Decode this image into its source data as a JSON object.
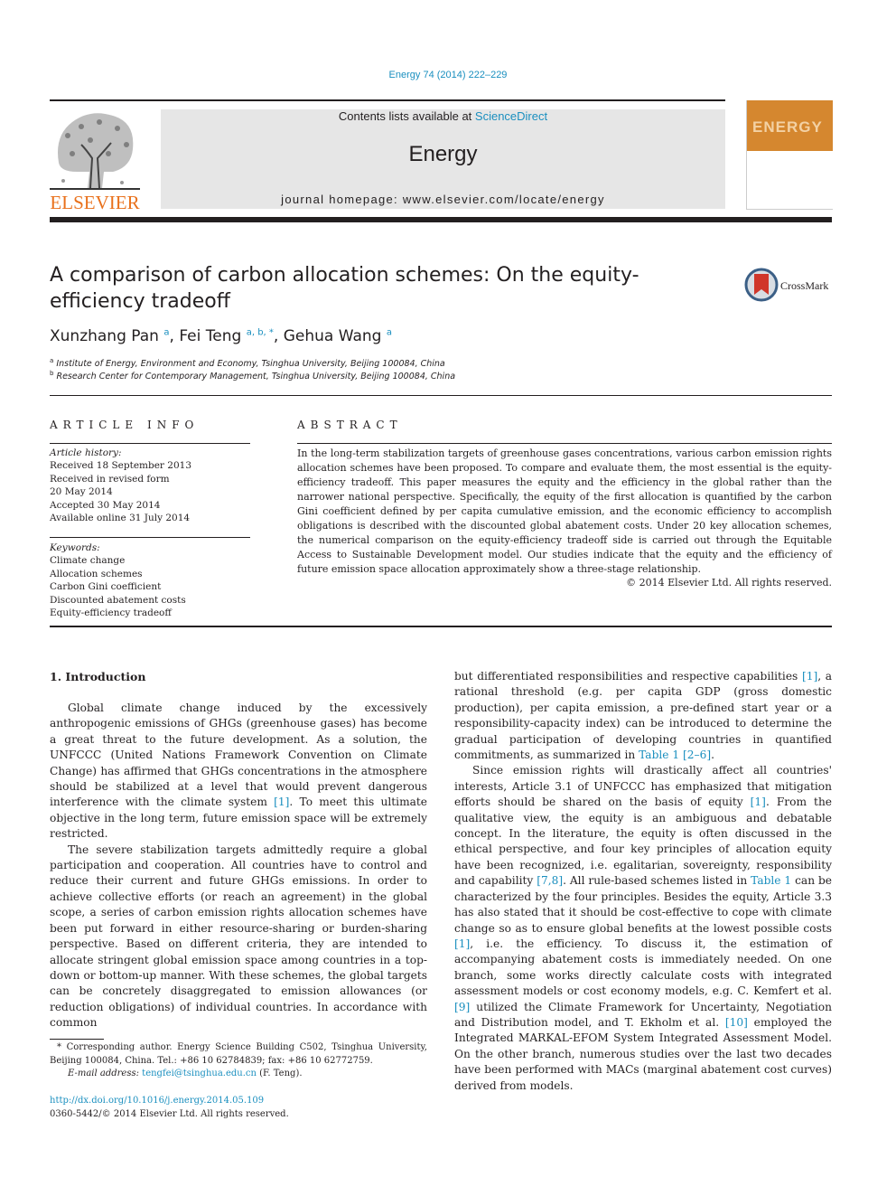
{
  "journal_ref": "Energy 74 (2014) 222–229",
  "header": {
    "publisher": "ELSEVIER",
    "contents_prefix": "Contents lists available at ",
    "contents_link": "ScienceDirect",
    "journal_name": "Energy",
    "homepage": "journal homepage: www.elsevier.com/locate/energy",
    "cover_title": "ENERGY"
  },
  "article": {
    "title": "A comparison of carbon allocation schemes: On the equity-efficiency tradeoff",
    "crossmark_label": "CrossMark",
    "authors": [
      {
        "name": "Xunzhang Pan",
        "sup": "a"
      },
      {
        "name": "Fei Teng",
        "sup": "a, b, *"
      },
      {
        "name": "Gehua Wang",
        "sup": "a"
      }
    ],
    "affiliations": [
      {
        "sup": "a",
        "text": "Institute of Energy, Environment and Economy, Tsinghua University, Beijing 100084, China"
      },
      {
        "sup": "b",
        "text": "Research Center for Contemporary Management, Tsinghua University, Beijing 100084, China"
      }
    ]
  },
  "article_info": {
    "heading": "ARTICLE INFO",
    "history_label": "Article history:",
    "history": [
      "Received 18 September 2013",
      "Received in revised form",
      "20 May 2014",
      "Accepted 30 May 2014",
      "Available online 31 July 2014"
    ],
    "keywords_label": "Keywords:",
    "keywords": [
      "Climate change",
      "Allocation schemes",
      "Carbon Gini coefficient",
      "Discounted abatement costs",
      "Equity-efficiency tradeoff"
    ]
  },
  "abstract": {
    "heading": "ABSTRACT",
    "text": "In the long-term stabilization targets of greenhouse gases concentrations, various carbon emission rights allocation schemes have been proposed. To compare and evaluate them, the most essential is the equity-efficiency tradeoff. This paper measures the equity and the efficiency in the global rather than the narrower national perspective. Specifically, the equity of the first allocation is quantified by the carbon Gini coefficient defined by per capita cumulative emission, and the economic efficiency to accomplish obligations is described with the discounted global abatement costs. Under 20 key allocation schemes, the numerical comparison on the equity-efficiency tradeoff side is carried out through the Equitable Access to Sustainable Development model. Our studies indicate that the equity and the efficiency of future emission space allocation approximately show a three-stage relationship.",
    "copyright": "© 2014 Elsevier Ltd. All rights reserved."
  },
  "body": {
    "section_heading": "1.  Introduction",
    "left_paragraphs": [
      {
        "parts": [
          {
            "t": "Global climate change induced by the excessively anthropogenic emissions of GHGs (greenhouse gases) has become a great threat to the future development. As a solution, the UNFCCC (United Nations Framework Convention on Climate Change) has affirmed that GHGs concentrations in the atmosphere should be stabilized at a level that would prevent dangerous interference with the climate system "
          },
          {
            "t": "[1]",
            "link": true
          },
          {
            "t": ". To meet this ultimate objective in the long term, future emission space will be extremely restricted."
          }
        ]
      },
      {
        "parts": [
          {
            "t": "The severe stabilization targets admittedly require a global participation and cooperation. All countries have to control and reduce their current and future GHGs emissions. In order to achieve collective efforts (or reach an agreement) in the global scope, a series of carbon emission rights allocation schemes have been put forward in either resource-sharing or burden-sharing perspective. Based on different criteria, they are intended to allocate stringent global emission space among countries in a top-down or bottom-up manner. With these schemes, the global targets can be concretely disaggregated to emission allowances (or reduction obligations) of individual countries. In accordance with common"
          }
        ]
      }
    ],
    "right_paragraphs": [
      {
        "noindent": true,
        "parts": [
          {
            "t": "but differentiated responsibilities and respective capabilities "
          },
          {
            "t": "[1]",
            "link": true
          },
          {
            "t": ", a rational threshold (e.g. per capita GDP (gross domestic production), per capita emission, a pre-defined start year or a responsibility-capacity index) can be introduced to determine the gradual participation of developing countries in quantified commitments, as summarized in "
          },
          {
            "t": "Table 1",
            "link": true
          },
          {
            "t": " "
          },
          {
            "t": "[2–6]",
            "link": true
          },
          {
            "t": "."
          }
        ]
      },
      {
        "parts": [
          {
            "t": "Since emission rights will drastically affect all countries' interests, Article 3.1 of UNFCCC has emphasized that mitigation efforts should be shared on the basis of equity "
          },
          {
            "t": "[1]",
            "link": true
          },
          {
            "t": ". From the qualitative view, the equity is an ambiguous and debatable concept. In the literature, the equity is often discussed in the ethical perspective, and four key principles of allocation equity have been recognized, i.e. egalitarian, sovereignty, responsibility and capability "
          },
          {
            "t": "[7,8]",
            "link": true
          },
          {
            "t": ". All rule-based schemes listed in "
          },
          {
            "t": "Table 1",
            "link": true
          },
          {
            "t": " can be characterized by the four principles. Besides the equity, Article 3.3 has also stated that it should be cost-effective to cope with climate change so as to ensure global benefits at the lowest possible costs "
          },
          {
            "t": "[1]",
            "link": true
          },
          {
            "t": ", i.e. the efficiency. To discuss it, the estimation of accompanying abatement costs is immediately needed. On one branch, some works directly calculate costs with integrated assessment models or cost economy models, e.g. C. Kemfert et al. "
          },
          {
            "t": "[9]",
            "link": true
          },
          {
            "t": " utilized the Climate Framework for Uncertainty, Negotiation and Distribution model, and T. Ekholm et al. "
          },
          {
            "t": "[10]",
            "link": true
          },
          {
            "t": " employed the Integrated MARKAL-EFOM System Integrated Assessment Model. On the other branch, numerous studies over the last two decades have been performed with MACs (marginal abatement cost curves) derived from models."
          }
        ]
      }
    ]
  },
  "footnotes": {
    "corresponding": "* Corresponding author. Energy Science Building C502, Tsinghua University, Beijing 100084, China. Tel.: +86 10 62784839; fax: +86 10 62772759.",
    "email_label": "E-mail address: ",
    "email": "tengfei@tsinghua.edu.cn",
    "email_suffix": " (F. Teng).",
    "doi": "http://dx.doi.org/10.1016/j.energy.2014.05.109",
    "issn": "0360-5442/© 2014 Elsevier Ltd. All rights reserved."
  }
}
